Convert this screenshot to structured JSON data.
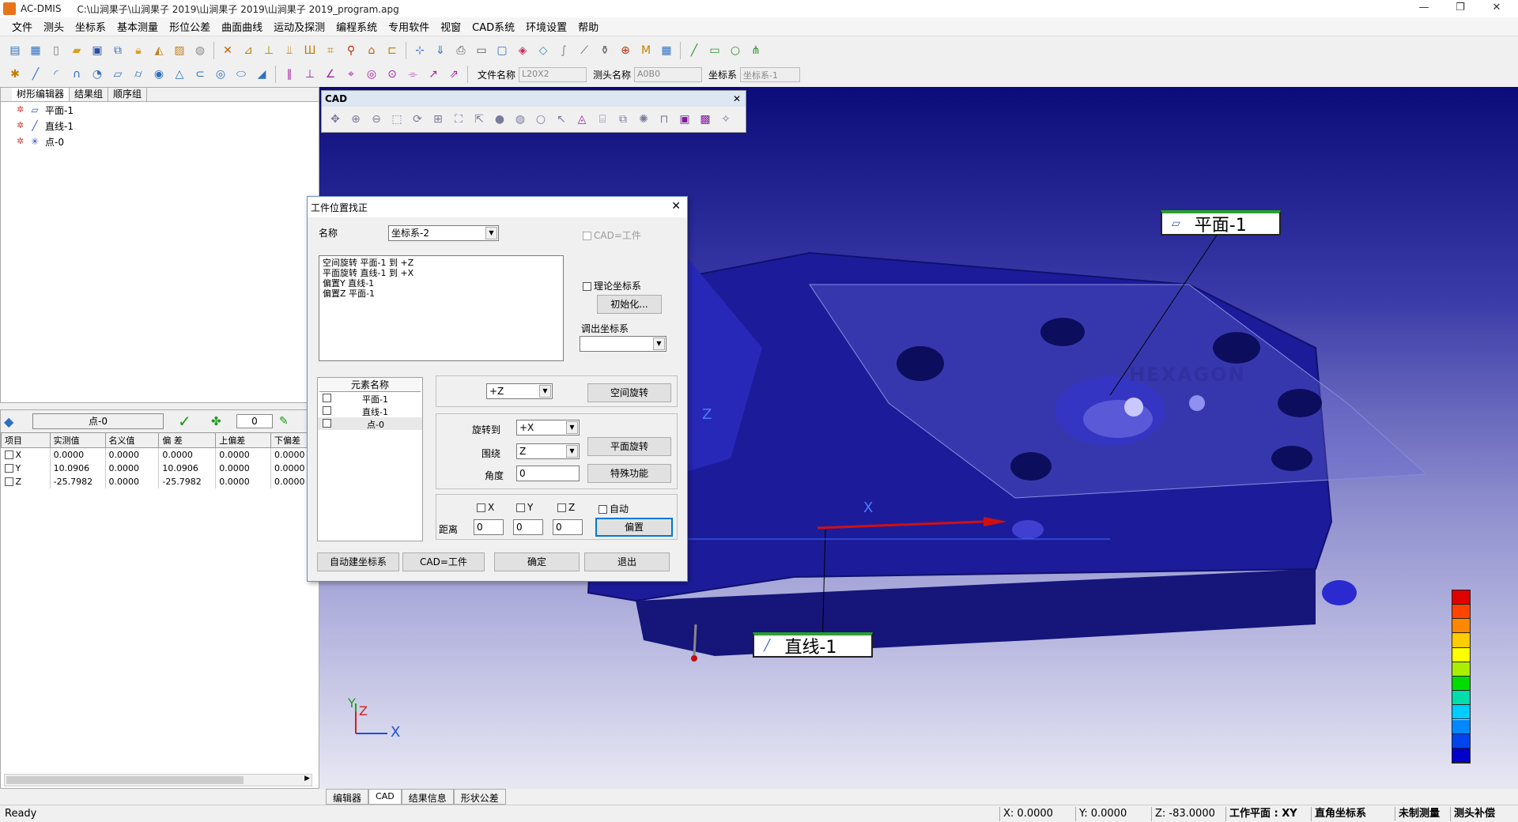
{
  "window": {
    "app_name": "AC-DMIS",
    "path": "C:\\山涧果子\\山涧果子 2019\\山涧果子 2019\\山涧果子 2019_program.apg",
    "minimize": "—",
    "restore": "❐",
    "close": "✕"
  },
  "menu": [
    "文件",
    "测头",
    "坐标系",
    "基本测量",
    "形位公差",
    "曲面曲线",
    "运动及探测",
    "编程系统",
    "专用软件",
    "视窗",
    "CAD系统",
    "环境设置",
    "帮助"
  ],
  "toolbar2": {
    "file_name_label": "文件名称",
    "file_name_value": "L20X2",
    "probe_name_label": "测头名称",
    "probe_name_value": "A0B0",
    "coord_label": "坐标系",
    "coord_value": "坐标系-1"
  },
  "tree": {
    "tabs": [
      "树形编辑器",
      "结果组",
      "顺序组"
    ],
    "items": [
      {
        "label": "平面-1",
        "icon": "plane-icon"
      },
      {
        "label": "直线-1",
        "icon": "line-icon"
      },
      {
        "label": "点-0",
        "icon": "point-icon"
      }
    ]
  },
  "results": {
    "element_name": "点-0",
    "counter": "0",
    "headers": [
      "项目",
      "实测值",
      "名义值",
      "偏 差",
      "上偏差",
      "下偏差"
    ],
    "rows": [
      [
        "X",
        "0.0000",
        "0.0000",
        "0.0000",
        "0.0000",
        "0.0000"
      ],
      [
        "Y",
        "10.0906",
        "0.0000",
        "10.0906",
        "0.0000",
        "0.0000"
      ],
      [
        "Z",
        "-25.7982",
        "0.0000",
        "-25.7982",
        "0.0000",
        "0.0000"
      ]
    ]
  },
  "cad_toolbar": {
    "title": "CAD",
    "close": "✕"
  },
  "dialog": {
    "title": "工件位置找正",
    "close": "✕",
    "name_label": "名称",
    "name_value": "坐标系-2",
    "cad_eq_part_label": "CAD=工件",
    "program_text": [
      "空间旋转 平面-1 到 +Z",
      "平面旋转 直线-1 到 +X",
      "偏置Y    直线-1",
      "偏置Z    平面-1"
    ],
    "theory_coord_label": "理论坐标系",
    "init_button": "初始化...",
    "recall_coord_label": "调出坐标系",
    "recall_coord_value": "",
    "elements_header": "元素名称",
    "elements": [
      "平面-1",
      "直线-1",
      "点-0"
    ],
    "space_rotate_dir": "+Z",
    "space_rotate_button": "空间旋转",
    "rotate_to_label": "旋转到",
    "rotate_to_value": "+X",
    "around_label": "围绕",
    "around_value": "Z",
    "plane_rotate_button": "平面旋转",
    "angle_label": "角度",
    "angle_value": "0",
    "special_button": "特殊功能",
    "x_label": "X",
    "y_label": "Y",
    "z_label": "Z",
    "auto_label": "自动",
    "distance_label": "距离",
    "dist_x": "0",
    "dist_y": "0",
    "dist_z": "0",
    "offset_button": "偏置",
    "auto_build_button": "自动建坐标系",
    "cad_part_button": "CAD=工件",
    "ok_button": "确定",
    "exit_button": "退出"
  },
  "viewport": {
    "plane_callout": "平面-1",
    "line_callout": "直线-1",
    "brand_text": "HEXAGON",
    "axis_x": "X",
    "axis_z": "Z",
    "triad_x": "X",
    "triad_y": "Y",
    "triad_z": "Z"
  },
  "bottom_tabs": [
    "编辑器",
    "CAD",
    "结果信息",
    "形状公差"
  ],
  "status": {
    "ready": "Ready",
    "x": "X: 0.0000",
    "y": "Y: 0.0000",
    "z": "Z: -83.0000",
    "workplane": "工作平面 : XY",
    "coord_sys": "直角坐标系",
    "measure": "未制测量",
    "probe_comp": "测头补偿"
  },
  "legend_colors": [
    "#e00000",
    "#ff4400",
    "#ff8800",
    "#ffcc00",
    "#ffff00",
    "#aaee00",
    "#00dd00",
    "#00ddaa",
    "#00ccff",
    "#0088ff",
    "#0044ee",
    "#0000cc"
  ]
}
